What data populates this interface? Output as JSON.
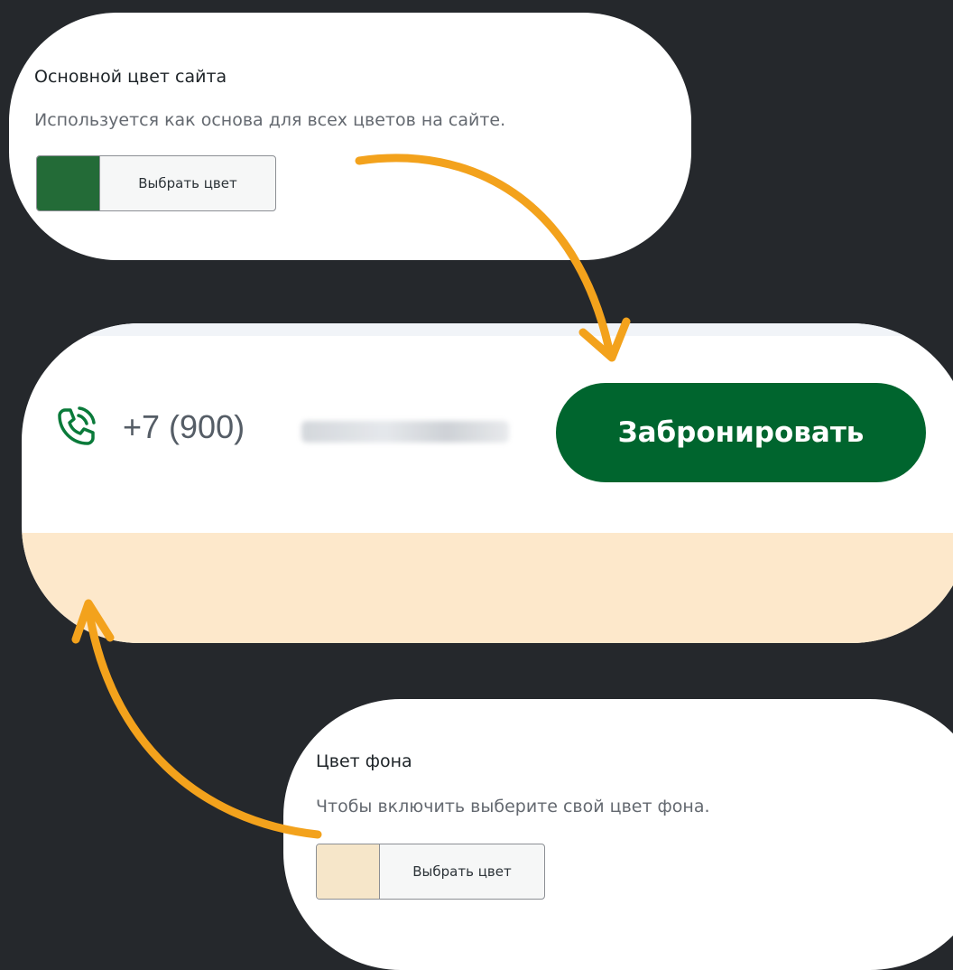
{
  "primary_color_setting": {
    "title": "Основной цвет сайта",
    "description": "Используется как основа для всех цветов на сайте.",
    "button_label": "Выбрать цвет",
    "swatch_color": "#236b37"
  },
  "preview": {
    "phone_prefix": "+7 (900)",
    "book_button_label": "Забронировать",
    "button_color": "#00652e",
    "phone_icon_color": "#0a7a3a",
    "background_color": "#fde8cb"
  },
  "background_color_setting": {
    "title": "Цвет фона",
    "description": "Чтобы включить выберите свой цвет фона.",
    "button_label": "Выбрать цвет",
    "swatch_color": "#f6e6c9"
  },
  "arrow_color": "#f3a21c"
}
